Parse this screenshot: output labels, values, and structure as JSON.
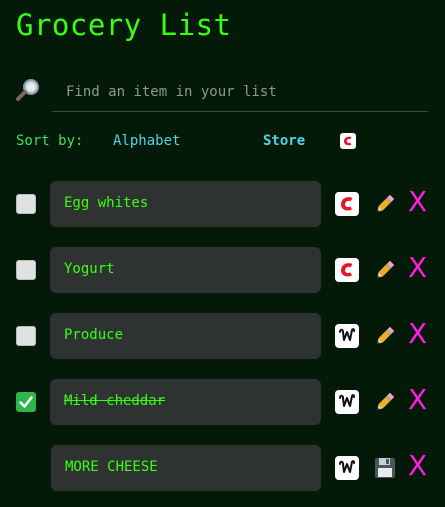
{
  "title": "Grocery List",
  "search": {
    "placeholder": "Find an item in your list",
    "value": ""
  },
  "sort": {
    "label": "Sort by:",
    "options": [
      "Alphabet",
      "Store"
    ],
    "selected": "Store"
  },
  "items": [
    {
      "name": "Egg whites",
      "checked": false,
      "store_icon": "c-logo",
      "action_icon": "pencil-icon",
      "delete": "X"
    },
    {
      "name": "Yogurt",
      "checked": false,
      "store_icon": "c-logo",
      "action_icon": "pencil-icon",
      "delete": "X"
    },
    {
      "name": "Produce",
      "checked": false,
      "store_icon": "w-logo",
      "action_icon": "pencil-icon",
      "delete": "X"
    },
    {
      "name": "Mild cheddar",
      "checked": true,
      "store_icon": "w-logo",
      "action_icon": "pencil-icon",
      "delete": "X"
    },
    {
      "name": "MORE CHEESE",
      "checked": null,
      "store_icon": "w-logo",
      "action_icon": "floppy-disk-icon",
      "delete": "X"
    }
  ],
  "colors": {
    "background": "#041a08",
    "text": "#39ff14",
    "link": "#4fd3e8",
    "delete": "#ff1ee0",
    "item_box": "#2e3331",
    "c_logo": "#e8162b"
  }
}
